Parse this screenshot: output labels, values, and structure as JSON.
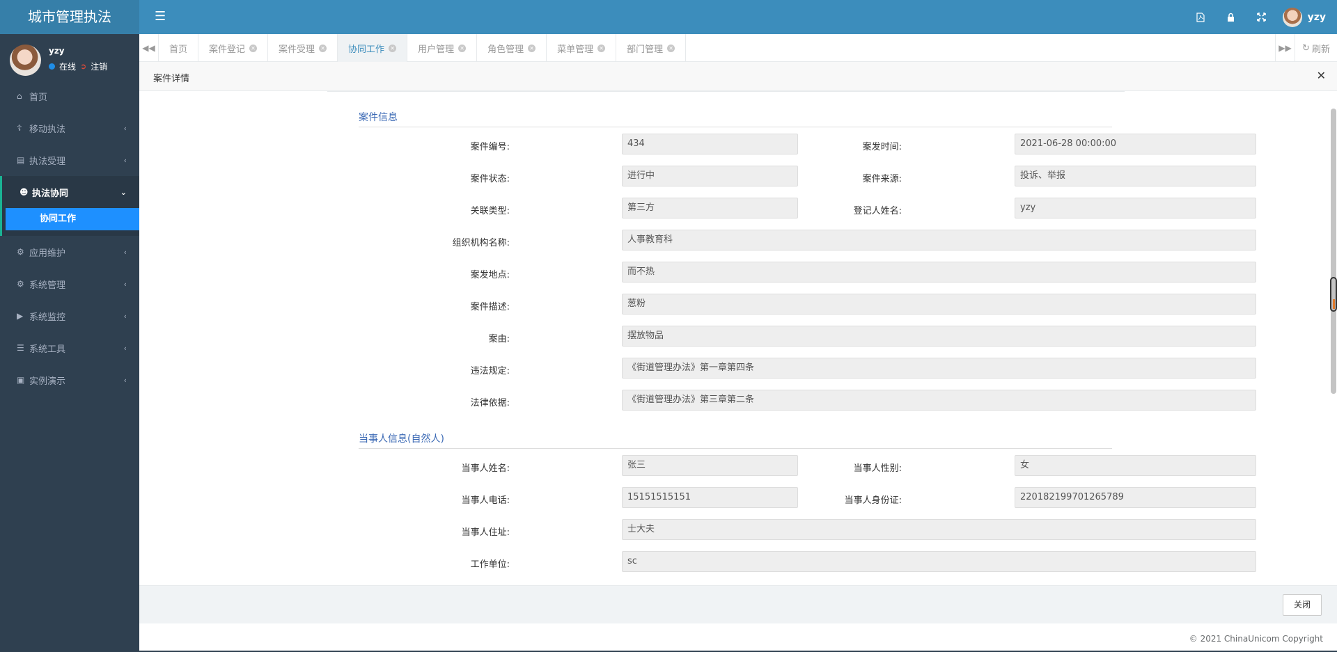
{
  "app": {
    "title": "城市管理执法"
  },
  "header": {
    "icons": [
      "pdf-icon",
      "lock-icon",
      "fullscreen-icon"
    ],
    "username": "yzy"
  },
  "sidebar": {
    "user": {
      "name": "yzy",
      "status": "在线",
      "logout": "注销"
    },
    "items": [
      {
        "label": "首页",
        "icon": "home-icon"
      },
      {
        "label": "移动执法",
        "icon": "bank-icon"
      },
      {
        "label": "执法受理",
        "icon": "list-icon"
      },
      {
        "label": "执法协同",
        "icon": "users-icon"
      },
      {
        "label": "应用维护",
        "icon": "gears-icon"
      },
      {
        "label": "系统管理",
        "icon": "gear-icon"
      },
      {
        "label": "系统监控",
        "icon": "video-icon"
      },
      {
        "label": "系统工具",
        "icon": "bars-icon"
      },
      {
        "label": "实例演示",
        "icon": "desktop-icon"
      }
    ],
    "subitem": "协同工作"
  },
  "tabs": {
    "items": [
      "首页",
      "案件登记",
      "案件受理",
      "协同工作",
      "用户管理",
      "角色管理",
      "菜单管理",
      "部门管理"
    ],
    "active": "协同工作",
    "refresh": "刷新"
  },
  "dialog": {
    "title": "案件详情",
    "close_button": "关闭"
  },
  "case_section": {
    "title": "案件信息",
    "case_no_label": "案件编号:",
    "case_no": "434",
    "time_label": "案发时间:",
    "time": "2021-06-28 00:00:00",
    "status_label": "案件状态:",
    "status": "进行中",
    "source_label": "案件来源:",
    "source": "投诉、举报",
    "rel_type_label": "关联类型:",
    "rel_type": "第三方",
    "registrant_label": "登记人姓名:",
    "registrant": "yzy",
    "org_label": "组织机构名称:",
    "org": "人事教育科",
    "place_label": "案发地点:",
    "place": "而不热",
    "desc_label": "案件描述:",
    "desc": "葱粉",
    "cause_label": "案由:",
    "cause": "摆放物品",
    "rule_label": "违法规定:",
    "rule": "《街道管理办法》第一章第四条",
    "basis_label": "法律依据:",
    "basis": "《街道管理办法》第三章第二条"
  },
  "party_section": {
    "title": "当事人信息(自然人)",
    "name_label": "当事人姓名:",
    "name": "张三",
    "gender_label": "当事人性别:",
    "gender": "女",
    "phone_label": "当事人电话:",
    "phone": "15151515151",
    "id_label": "当事人身份证:",
    "id": "220182199701265789",
    "address_label": "当事人住址:",
    "address": "士大夫",
    "work_label": "工作单位:",
    "work": "sc"
  },
  "footer": {
    "copyright": "© 2021 ChinaUnicom Copyright"
  }
}
